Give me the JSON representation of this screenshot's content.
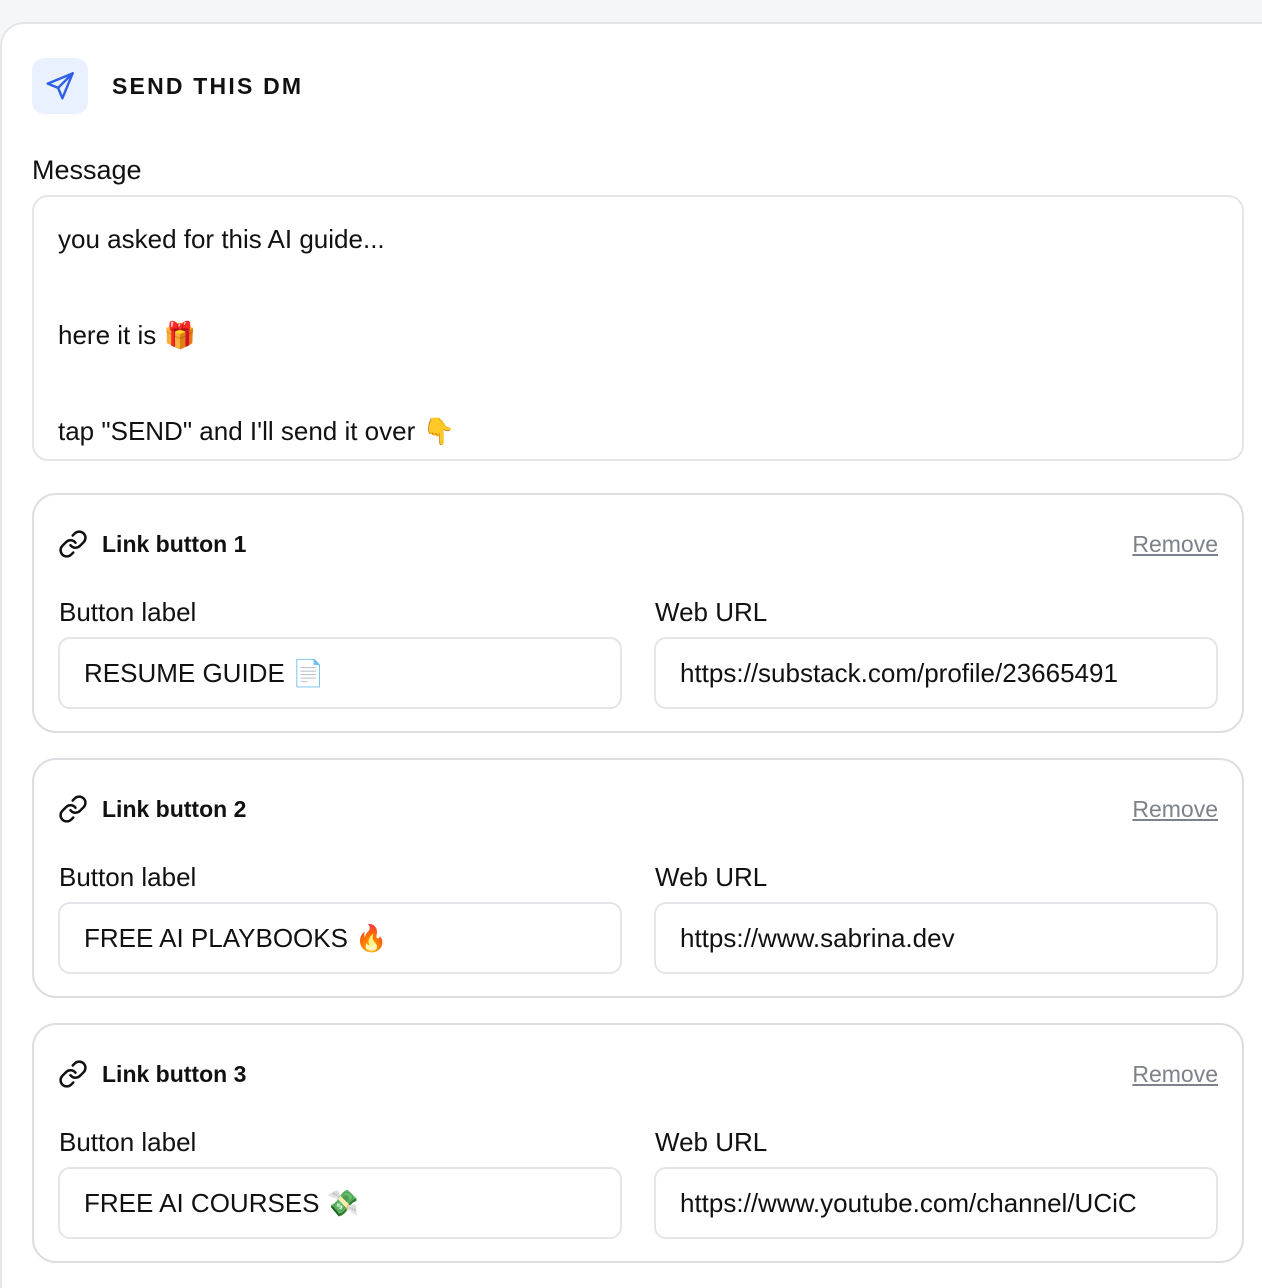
{
  "header": {
    "title": "SEND THIS DM",
    "icon": "send-icon",
    "icon_color": "#2f5ee8",
    "icon_bg": "#eaf1fe"
  },
  "message": {
    "label": "Message",
    "lines": [
      "you asked for this AI guide...",
      "",
      "here it is 🎁",
      "",
      "tap \"SEND\" and I'll send it over 👇"
    ]
  },
  "link_buttons": [
    {
      "title": "Link button 1",
      "remove_label": "Remove",
      "label_field_label": "Button label",
      "label_value": "RESUME GUIDE 📄",
      "url_field_label": "Web URL",
      "url_value": "https://substack.com/profile/23665491"
    },
    {
      "title": "Link button 2",
      "remove_label": "Remove",
      "label_field_label": "Button label",
      "label_value": "FREE AI PLAYBOOKS 🔥",
      "url_field_label": "Web URL",
      "url_value": "https://www.sabrina.dev"
    },
    {
      "title": "Link button 3",
      "remove_label": "Remove",
      "label_field_label": "Button label",
      "label_value": "FREE AI COURSES 💸",
      "url_field_label": "Web URL",
      "url_value": "https://www.youtube.com/channel/UCiC"
    }
  ]
}
